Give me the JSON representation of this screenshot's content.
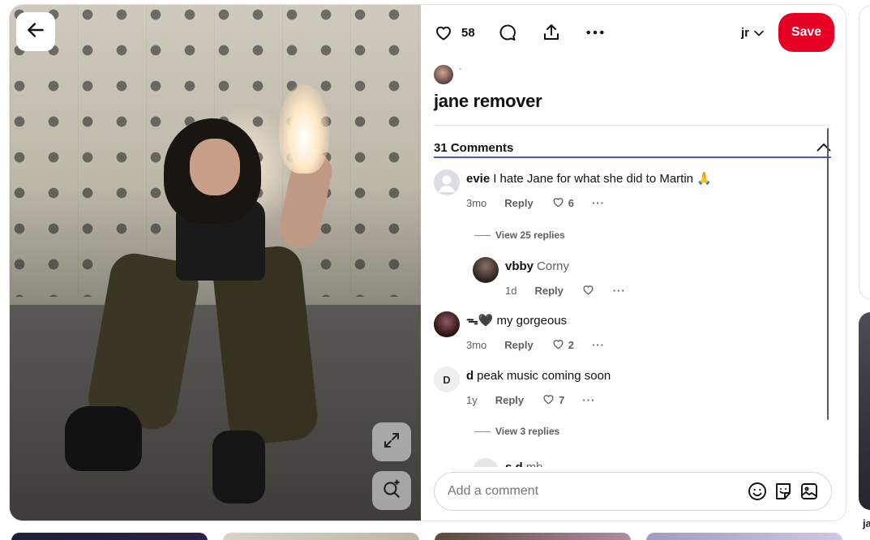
{
  "pin": {
    "back_label": "Back",
    "title": "jane remover",
    "owner_dot": "·"
  },
  "toolbar": {
    "like_count": "58",
    "board_name": "jr",
    "save_label": "Save"
  },
  "comments": {
    "count_label": "31 Comments",
    "items": [
      {
        "name": "evie",
        "text": "I hate Jane for what she did to Martin 🙏",
        "time": "3mo",
        "reply": "Reply",
        "likes": "6",
        "avatar_color": "#dcdde4"
      },
      {
        "name": "vbby",
        "text": "Corny",
        "time": "1d",
        "reply": "Reply",
        "likes": "",
        "avatar_color": "#3b2f2a"
      },
      {
        "name": "ᯓ🖤",
        "text": "my gorgeous",
        "time": "3mo",
        "reply": "Reply",
        "likes": "2",
        "avatar_color": "#4a1f25"
      },
      {
        "name": "d",
        "text": "peak music coming soon",
        "time": "1y",
        "reply": "Reply",
        "likes": "7",
        "avatar_letter": "D",
        "avatar_color": "#efefef"
      },
      {
        "name": "s d",
        "text": "mb",
        "avatar_color": "#e6e6e6"
      }
    ],
    "view_replies_1": "View 25 replies",
    "view_replies_2": "View 3 replies"
  },
  "composer": {
    "placeholder": "Add a comment"
  },
  "side": {
    "right_label": "ja"
  },
  "colors": {
    "save_red": "#e60023",
    "tab_underline": "#4a5ac7"
  }
}
